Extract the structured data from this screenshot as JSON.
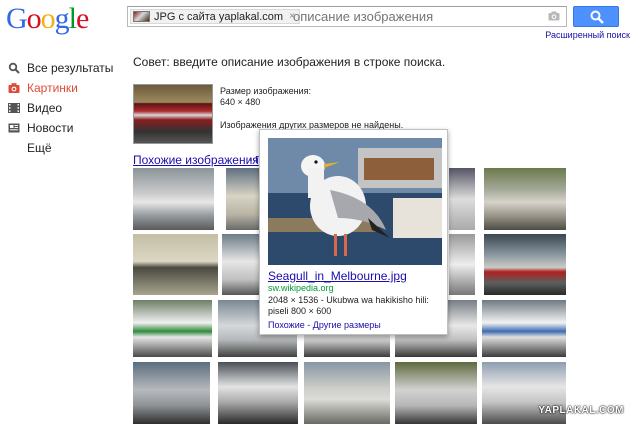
{
  "logo": {
    "letters": [
      "G",
      "o",
      "o",
      "g",
      "l",
      "e"
    ],
    "colors": [
      "#3369e8",
      "#d50f25",
      "#eeb211",
      "#3369e8",
      "#009925",
      "#d50f25"
    ]
  },
  "search": {
    "chip_label": "JPG с сайта yaplakal.com",
    "chip_close": "×",
    "placeholder": "описание изображения",
    "advanced_link": "Расширенный поиск"
  },
  "sidebar": {
    "items": [
      {
        "label": "Все результаты",
        "icon": "search-icon",
        "active": false
      },
      {
        "label": "Картинки",
        "icon": "camera-icon",
        "active": true
      },
      {
        "label": "Видео",
        "icon": "film-icon",
        "active": false
      },
      {
        "label": "Новости",
        "icon": "newspaper-icon",
        "active": false
      },
      {
        "label": "Ещё",
        "icon": "",
        "active": false
      }
    ]
  },
  "main": {
    "tip": "Совет: введите описание изображения в строке поиска.",
    "size_label": "Размер изображения:",
    "size_value": "640 × 480",
    "other_sizes": "Изображения других размеров не найдены.",
    "similar_link": "Похожие изображения",
    "similar_extra": "- П"
  },
  "popup": {
    "title": "Seagull_in_Melbourne.jpg",
    "site": "sw.wikipedia.org",
    "dims": "2048 × 1536 - Ukubwa wa hakikisho hili:",
    "dims2": "piseli 800 × 600",
    "links": "Похожие - Другие размеры"
  },
  "watermark": "YAPLAKAL.COM",
  "colors": {
    "accent_blue": "#4d90fe",
    "link": "#1a0dab",
    "active_red": "#dd4b39",
    "url_green": "#009933"
  }
}
